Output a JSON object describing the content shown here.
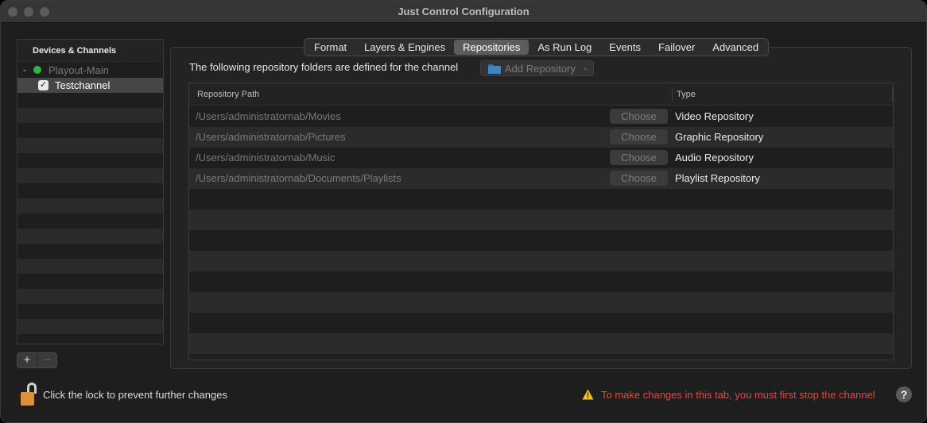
{
  "window": {
    "title": "Just Control Configuration"
  },
  "sidebar": {
    "header": "Devices & Channels",
    "items": [
      {
        "label": "Playout-Main",
        "status_color": "#29b84a"
      },
      {
        "label": "Testchannel",
        "checked": true
      }
    ]
  },
  "toolbar": {
    "add_label": "+",
    "remove_label": "−"
  },
  "tabs": [
    "Format",
    "Layers & Engines",
    "Repositories",
    "As Run Log",
    "Events",
    "Failover",
    "Advanced"
  ],
  "active_tab": "Repositories",
  "repositories": {
    "description": "The following repository folders are defined for the channel",
    "add_button": "Add Repository",
    "columns": {
      "path": "Repository Path",
      "type": "Type"
    },
    "choose_label": "Choose",
    "rows": [
      {
        "path": "/Users/administratornab/Movies",
        "type": "Video Repository"
      },
      {
        "path": "/Users/administratornab/Pictures",
        "type": "Graphic Repository"
      },
      {
        "path": "/Users/administratornab/Music",
        "type": "Audio Repository"
      },
      {
        "path": "/Users/administratornab/Documents/Playlists",
        "type": "Playlist Repository"
      }
    ]
  },
  "footer": {
    "lock_text": "Click the lock to prevent further changes",
    "warning_text": "To make changes in this tab, you must first stop the channel",
    "help_label": "?"
  }
}
